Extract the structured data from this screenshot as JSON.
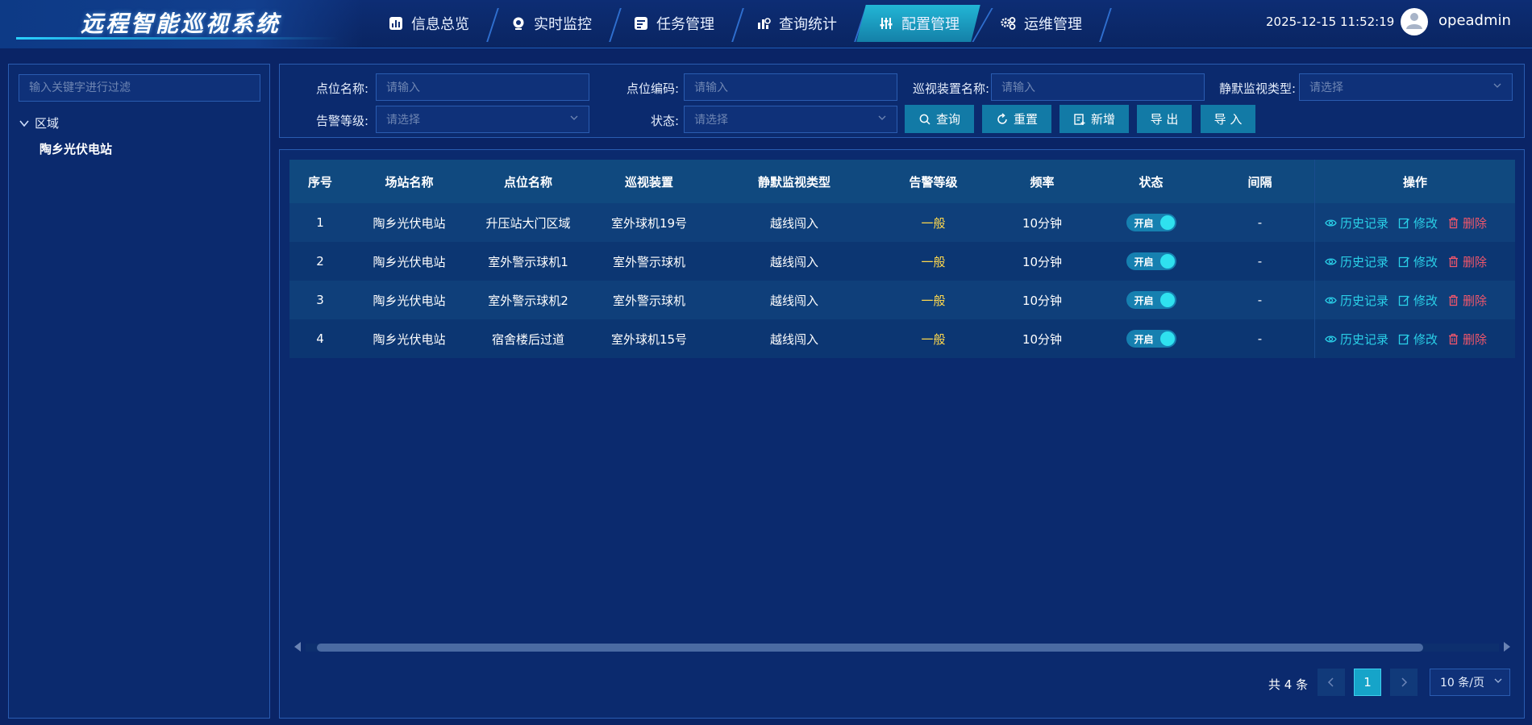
{
  "app": {
    "title": "远程智能巡视系统"
  },
  "nav": [
    {
      "label": "信息总览",
      "icon": "bar-chart-icon"
    },
    {
      "label": "实时监控",
      "icon": "webcam-icon"
    },
    {
      "label": "任务管理",
      "icon": "task-list-icon"
    },
    {
      "label": "查询统计",
      "icon": "statistics-icon"
    },
    {
      "label": "配置管理",
      "icon": "sliders-icon",
      "active": true
    },
    {
      "label": "运维管理",
      "icon": "gears-icon"
    }
  ],
  "header": {
    "datetime": "2025-12-15 11:52:19",
    "username": "opeadmin"
  },
  "tree": {
    "filter_placeholder": "输入关键字进行过滤",
    "root": "区域",
    "children": [
      "陶乡光伏电站"
    ]
  },
  "filters": {
    "point_name_label": "点位名称:",
    "point_name_placeholder": "请输入",
    "point_code_label": "点位编码:",
    "point_code_placeholder": "请输入",
    "device_name_label": "巡视装置名称:",
    "device_name_placeholder": "请输入",
    "silent_type_label": "静默监视类型:",
    "silent_type_placeholder": "请选择",
    "alarm_level_label": "告警等级:",
    "alarm_level_placeholder": "请选择",
    "status_label": "状态:",
    "status_placeholder": "请选择"
  },
  "buttons": {
    "query": "查询",
    "reset": "重置",
    "add": "新增",
    "export": "导 出",
    "import": "导 入"
  },
  "table": {
    "columns": [
      "序号",
      "场站名称",
      "点位名称",
      "巡视装置",
      "静默监视类型",
      "告警等级",
      "频率",
      "状态",
      "间隔",
      "操作"
    ],
    "rows": [
      {
        "seq": "1",
        "station": "陶乡光伏电站",
        "point": "升压站大门区域",
        "device": "室外球机19号",
        "type": "越线闯入",
        "alarm": "一般",
        "freq": "10分钟",
        "status": "开启",
        "interval": "-"
      },
      {
        "seq": "2",
        "station": "陶乡光伏电站",
        "point": "室外警示球机1",
        "device": "室外警示球机",
        "type": "越线闯入",
        "alarm": "一般",
        "freq": "10分钟",
        "status": "开启",
        "interval": "-"
      },
      {
        "seq": "3",
        "station": "陶乡光伏电站",
        "point": "室外警示球机2",
        "device": "室外警示球机",
        "type": "越线闯入",
        "alarm": "一般",
        "freq": "10分钟",
        "status": "开启",
        "interval": "-"
      },
      {
        "seq": "4",
        "station": "陶乡光伏电站",
        "point": "宿舍楼后过道",
        "device": "室外球机15号",
        "type": "越线闯入",
        "alarm": "一般",
        "freq": "10分钟",
        "status": "开启",
        "interval": "-"
      }
    ],
    "ops": {
      "history": "历史记录",
      "edit": "修改",
      "delete": "删除"
    }
  },
  "pagination": {
    "total": "共 4 条",
    "current": "1",
    "page_size": "10 条/页"
  },
  "colors": {
    "accent": "#127aa6",
    "alarm": "#ffd84d",
    "delete": "#f0566b",
    "link": "#2ad0e8"
  }
}
